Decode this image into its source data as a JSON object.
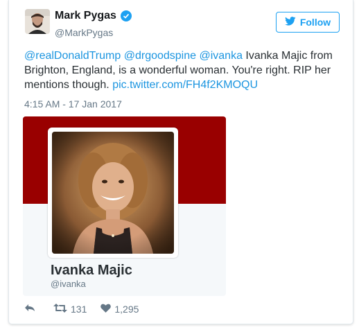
{
  "tweet": {
    "author": {
      "name": "Mark Pygas",
      "handle": "@MarkPygas",
      "avatar_icon": "user-avatar",
      "verified_icon": "verified-badge-icon"
    },
    "follow_button": {
      "label": "Follow",
      "icon": "twitter-bird-icon"
    },
    "text": {
      "mention1": "@realDonaldTrump",
      "mention2": "@drgoodspine",
      "mention3": "@ivanka",
      "body": " Ivanka Majic from Brighton, England, is a wonderful woman. You're right. RIP her mentions though. ",
      "link": "pic.twitter.com/FH4f2KMOQU"
    },
    "timestamp": "4:15 AM - 17 Jan 2017",
    "embedded_profile": {
      "name": "Ivanka Majic",
      "handle": "@ivanka",
      "banner_color": "#990000"
    },
    "actions": {
      "reply_icon": "reply-icon",
      "retweet_icon": "retweet-icon",
      "retweet_count": "131",
      "like_icon": "heart-icon",
      "like_count": "1,295"
    }
  },
  "colors": {
    "accent": "#1da1f2",
    "link": "#1b95e0",
    "muted": "#657786"
  }
}
